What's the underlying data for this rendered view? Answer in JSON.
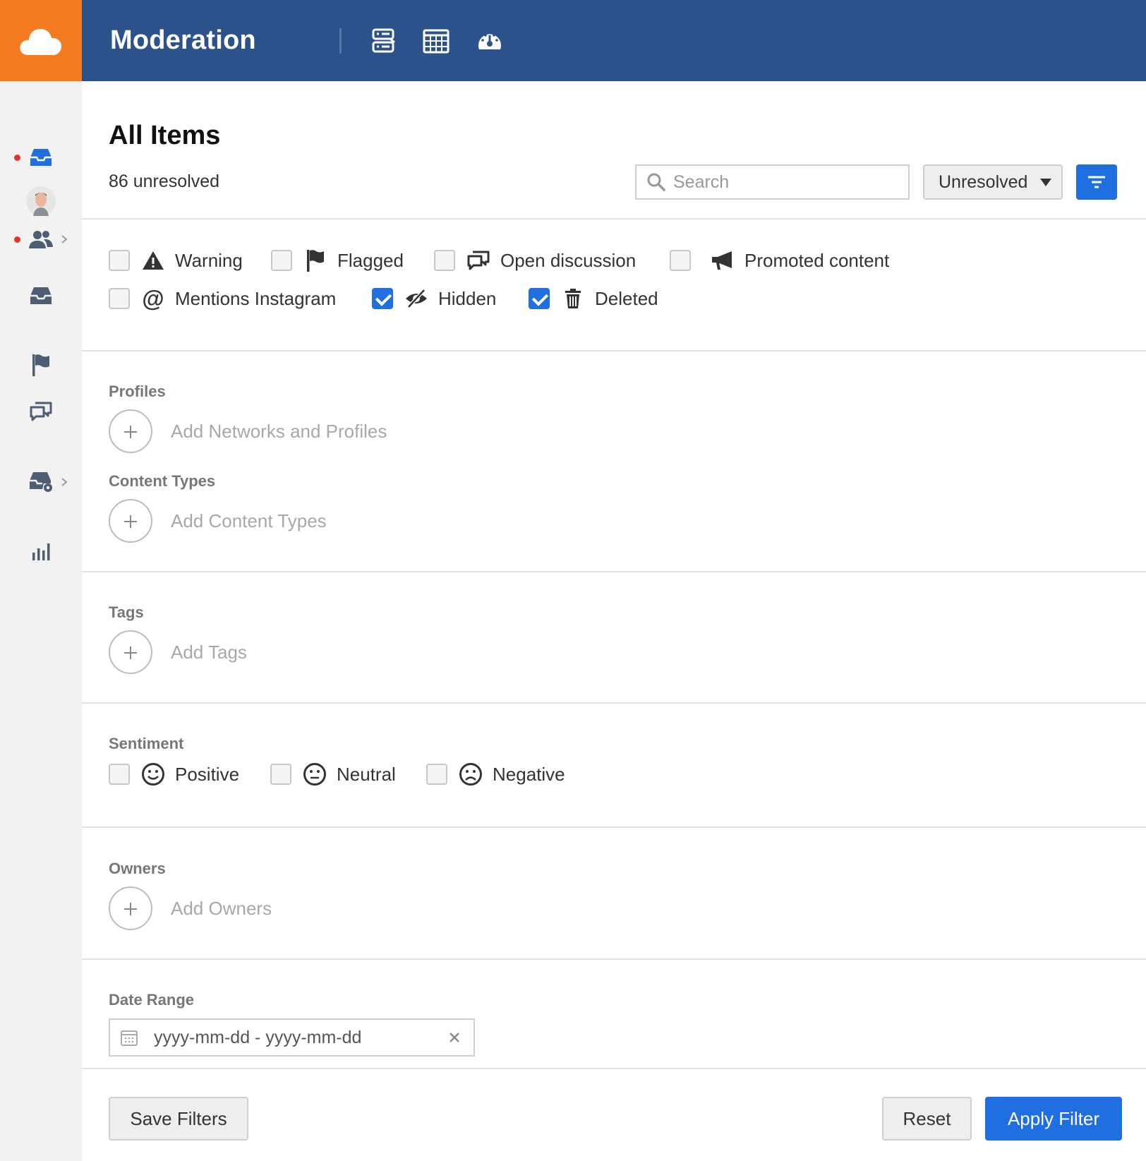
{
  "app": {
    "title": "Moderation"
  },
  "topbar_icons": [
    "list-icon",
    "calendar-icon",
    "dashboard-icon"
  ],
  "sidebar": {
    "items": [
      {
        "icon": "inbox-icon",
        "active": true,
        "notification": true
      },
      {
        "icon": "avatar"
      },
      {
        "icon": "users-icon",
        "notification": true,
        "has_submenu": true
      },
      {
        "icon": "inbox-icon"
      },
      {
        "icon": "flag-icon"
      },
      {
        "icon": "discussion-icon"
      },
      {
        "icon": "inbox-settings-icon",
        "has_submenu": true
      },
      {
        "icon": "bar-chart-icon"
      }
    ]
  },
  "header": {
    "title": "All Items",
    "count_text": "86 unresolved",
    "search_placeholder": "Search",
    "status_selected": "Unresolved"
  },
  "item_filters": [
    {
      "label": "Warning",
      "icon": "warning-icon",
      "checked": false
    },
    {
      "label": "Flagged",
      "icon": "flag-icon",
      "checked": false
    },
    {
      "label": "Open discussion",
      "icon": "discussion-icon",
      "checked": false
    },
    {
      "label": "Promoted content",
      "icon": "megaphone-icon",
      "checked": false
    },
    {
      "label": "Mentions Instagram",
      "icon": "at-icon",
      "checked": false
    },
    {
      "label": "Hidden",
      "icon": "eye-slash-icon",
      "checked": true
    },
    {
      "label": "Deleted",
      "icon": "trash-icon",
      "checked": true
    }
  ],
  "profiles": {
    "label": "Profiles",
    "add_label": "Add Networks and Profiles"
  },
  "content_types": {
    "label": "Content Types",
    "add_label": "Add Content Types"
  },
  "tags": {
    "label": "Tags",
    "add_label": "Add Tags"
  },
  "sentiment": {
    "label": "Sentiment",
    "options": [
      {
        "label": "Positive",
        "icon": "smile-icon",
        "checked": false
      },
      {
        "label": "Neutral",
        "icon": "neutral-face-icon",
        "checked": false
      },
      {
        "label": "Negative",
        "icon": "frown-icon",
        "checked": false
      }
    ]
  },
  "owners": {
    "label": "Owners",
    "add_label": "Add Owners"
  },
  "date_range": {
    "label": "Date Range",
    "placeholder": "yyyy-mm-dd - yyyy-mm-dd"
  },
  "actions": {
    "save": "Save Filters",
    "reset": "Reset",
    "apply": "Apply Filter"
  },
  "colors": {
    "topbar": "#2b528b",
    "logo_bg": "#f47b20",
    "accent": "#1f6fe0",
    "notification": "#e0352b"
  }
}
